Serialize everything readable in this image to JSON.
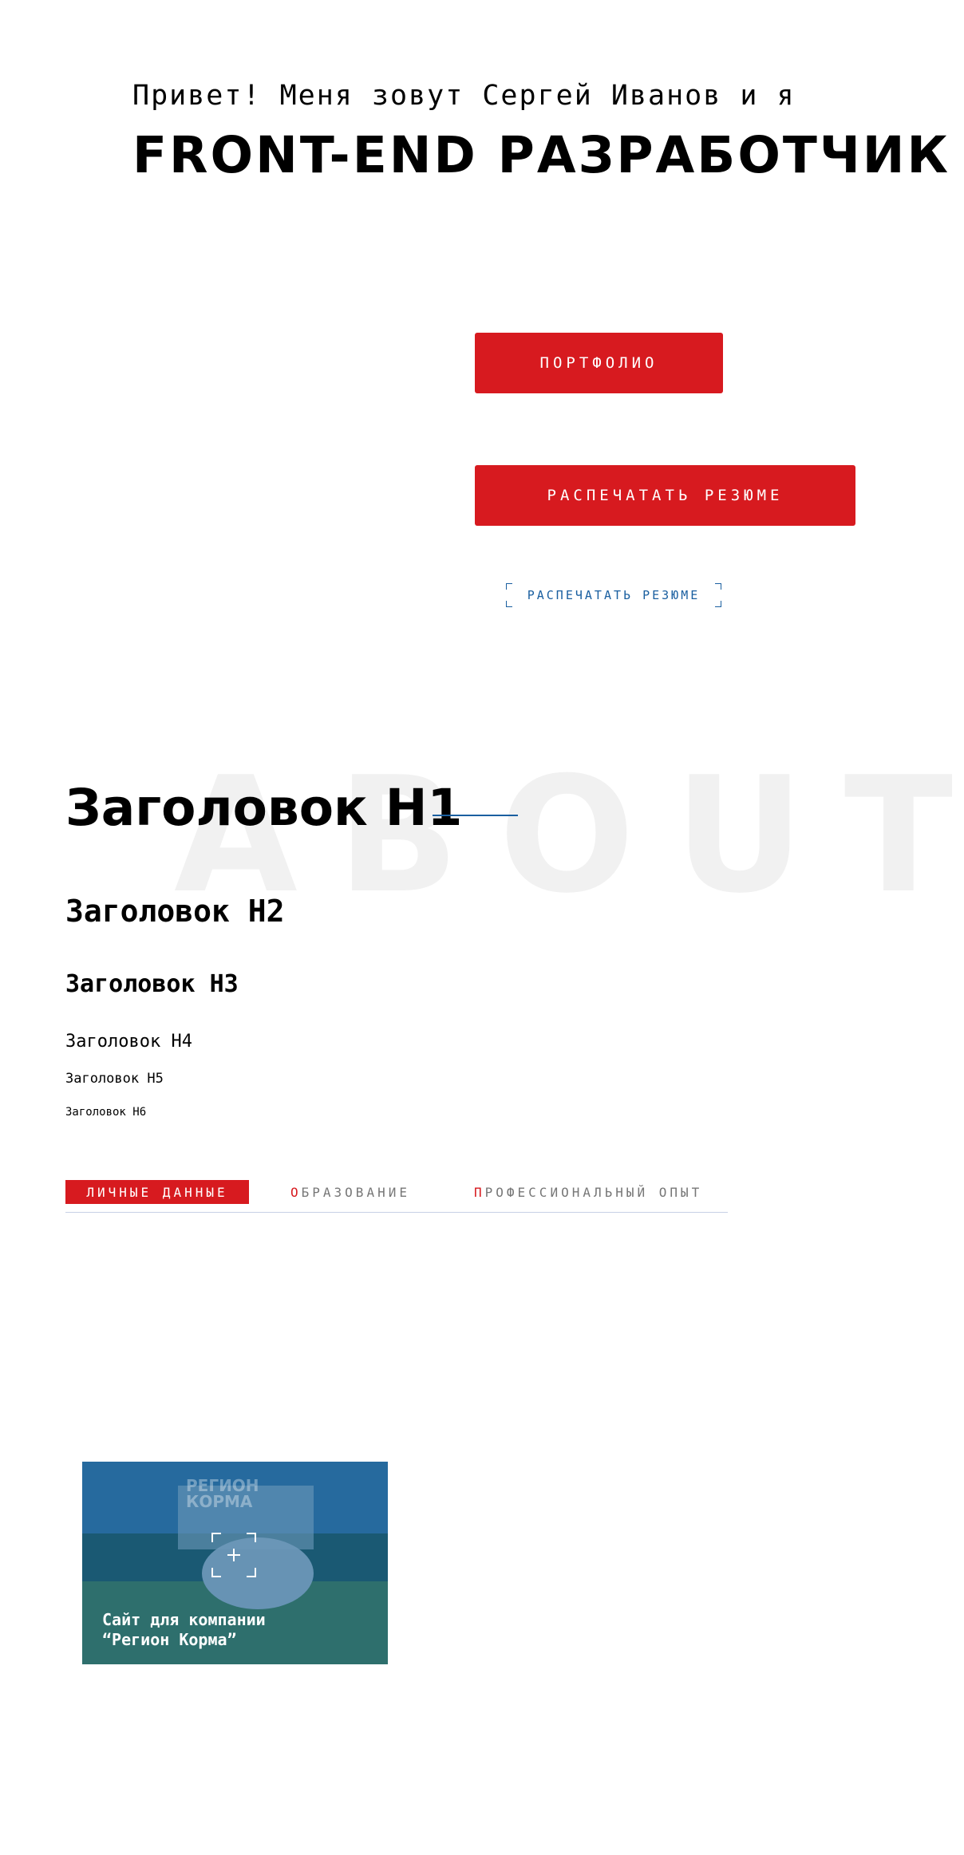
{
  "hero": {
    "greeting": "Привет! Меня зовут Сергей Иванов и я",
    "role": "FRONT-END РАЗРАБОТЧИК"
  },
  "buttons": {
    "portfolio": "ПОРТФОЛИО",
    "print_resume": "РАСПЕЧАТАТЬ РЕЗЮМЕ",
    "print_resume_outline": "РАСПЕЧАТАТЬ РЕЗЮМЕ"
  },
  "typography": {
    "background_word": "ABOUT",
    "h1": "Заголовок H1",
    "h2": "Заголовок H2",
    "h3": "Заголовок H3",
    "h4": "Заголовок H4",
    "h5": "Заголовок H5",
    "h6": "Заголовок H6"
  },
  "tabs": {
    "personal": "ЛИЧНЫЕ ДАННЫЕ",
    "education_first": "О",
    "education_rest": "БРАЗОВАНИЕ",
    "experience_first": "П",
    "experience_rest": "РОФЕССИОНАЛЬНЫЙ ОПЫТ"
  },
  "portfolio_card": {
    "logo_line1": "РЕГИОН",
    "logo_line2": "КОРМА",
    "caption_line1": "Сайт для компании",
    "caption_line2": "“Регион Корма”",
    "icon": "zoom-plus-icon"
  },
  "colors": {
    "accent_red": "#d71a1f",
    "accent_blue": "#1a5fa0",
    "background_word": "#f1f1f1"
  }
}
